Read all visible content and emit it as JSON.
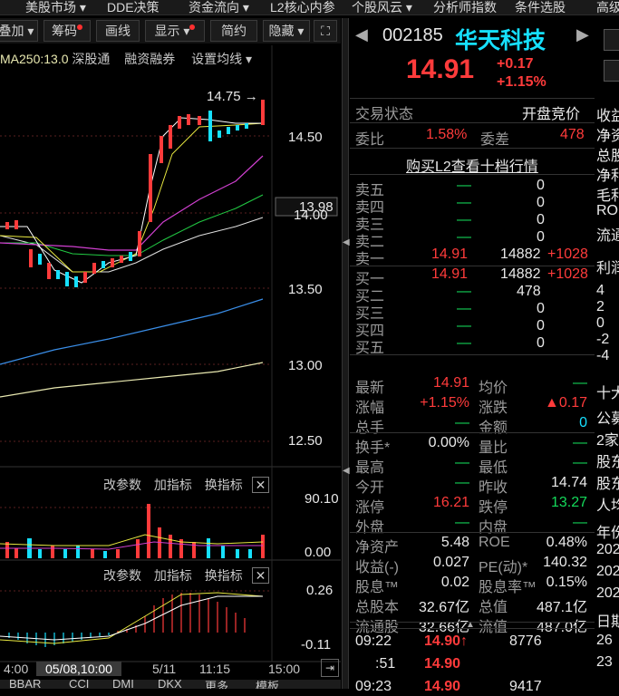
{
  "menu": [
    "美股市场 ▾",
    "DDE决策",
    "资金流向 ▾",
    "L2核心内参",
    "个股风云 ▾",
    "分析师指数",
    "条件选股",
    "高级"
  ],
  "toolbar": {
    "b0": "叠加 ▾",
    "b1": "筹码",
    "b2": "画线",
    "b3": "显示 ▾",
    "b4": "简约",
    "b5": "隐藏 ▾",
    "b6": "⛶"
  },
  "ma_legend": {
    "ma250": "MA250:13.0",
    "tong": "深股通",
    "rzrq": "融资融券",
    "set": "设置均线 ▾"
  },
  "price_axis": [
    "14.50",
    "14.00",
    "13.50",
    "13.00",
    "12.50"
  ],
  "current_price_tag": "13.98",
  "peak_label": "14.75 →",
  "vol_panel": {
    "btn1": "改参数",
    "btn2": "加指标",
    "btn3": "换指标",
    "close": "✕",
    "top": "90.10",
    "bottom": "0.00"
  },
  "macd_panel": {
    "btn1": "改参数",
    "btn2": "加指标",
    "btn3": "换指标",
    "close": "✕",
    "top": "0.26",
    "bottom": "-0.11"
  },
  "time_axis": {
    "t1": "4:00",
    "t2": "05/08,10:00",
    "t3": "5/11",
    "t4": "11:15",
    "t5": "15:00"
  },
  "bottom_tabs": [
    "BBAR",
    "CCI",
    "DMI",
    "DKX",
    "更多",
    "模板"
  ],
  "stock": {
    "code": "002185",
    "name": "华天科技",
    "price": "14.91",
    "change": "+0.17",
    "pct": "+1.15%"
  },
  "trade_status": {
    "label": "交易状态",
    "value": "开盘竞价"
  },
  "weibi": {
    "label1": "委比",
    "v1": "1.58%",
    "label2": "委差",
    "v2": "478"
  },
  "buy_l2": "购买L2查看十档行情",
  "sells": [
    {
      "label": "卖五",
      "price": "—",
      "vol": "0",
      "chg": ""
    },
    {
      "label": "卖四",
      "price": "—",
      "vol": "0",
      "chg": ""
    },
    {
      "label": "卖三",
      "price": "—",
      "vol": "0",
      "chg": ""
    },
    {
      "label": "卖二",
      "price": "—",
      "vol": "0",
      "chg": ""
    },
    {
      "label": "卖一",
      "price": "14.91",
      "vol": "14882",
      "chg": "+1028"
    }
  ],
  "buys": [
    {
      "label": "买一",
      "price": "14.91",
      "vol": "14882",
      "chg": "+1028"
    },
    {
      "label": "买二",
      "price": "—",
      "vol": "478",
      "chg": ""
    },
    {
      "label": "买三",
      "price": "—",
      "vol": "0",
      "chg": ""
    },
    {
      "label": "买四",
      "price": "—",
      "vol": "0",
      "chg": ""
    },
    {
      "label": "买五",
      "price": "—",
      "vol": "0",
      "chg": ""
    }
  ],
  "stats": [
    {
      "l1": "最新",
      "v1": "14.91",
      "l2": "均价",
      "v2": "—"
    },
    {
      "l1": "涨幅",
      "v1": "+1.15%",
      "l2": "涨跌",
      "v2": "▲0.17"
    },
    {
      "l1": "总手",
      "v1": "—",
      "l2": "金额",
      "v2": "0"
    },
    {
      "l1": "换手*",
      "v1": "0.00%",
      "l2": "量比",
      "v2": "—"
    },
    {
      "l1": "最高",
      "v1": "—",
      "l2": "最低",
      "v2": "—"
    },
    {
      "l1": "今开",
      "v1": "—",
      "l2": "昨收",
      "v2": "14.74"
    },
    {
      "l1": "涨停",
      "v1": "16.21",
      "l2": "跌停",
      "v2": "13.27"
    },
    {
      "l1": "外盘",
      "v1": "—",
      "l2": "内盘",
      "v2": "—"
    },
    {
      "l1": "净资产",
      "v1": "5.48",
      "l2": "ROE",
      "v2": "0.48%"
    },
    {
      "l1": "收益(-)",
      "v1": "0.027",
      "l2": "PE(动)*",
      "v2": "140.32"
    },
    {
      "l1": "股息™",
      "v1": "0.02",
      "l2": "股息率™",
      "v2": "0.15%"
    },
    {
      "l1": "总股本",
      "v1": "32.67亿",
      "l2": "总值",
      "v2": "487.1亿"
    },
    {
      "l1": "流通股",
      "v1": "32.66亿",
      "l2": "流值",
      "v2": "487.0亿"
    }
  ],
  "ticks": [
    {
      "time": "09:22",
      "price": "14.90↑",
      "vol": "8776"
    },
    {
      "time": ":51",
      "price": "14.90",
      "vol": ""
    },
    {
      "time": "09:23",
      "price": "14.90",
      "vol": "9417"
    }
  ],
  "far_panel": [
    "收益",
    "净资",
    "总股",
    "净利",
    "毛利",
    "ROE",
    "流通",
    "利润",
    "4",
    "2",
    "0",
    "-2",
    "-4",
    "十大",
    "公募",
    "2家",
    "股东",
    "股东",
    "人均",
    "年份",
    "202",
    "202",
    "202",
    "日期",
    "26",
    "23"
  ],
  "colors": {
    "up": "#ff3b3b",
    "down": "#14d95a",
    "name": "#16e0ff"
  }
}
